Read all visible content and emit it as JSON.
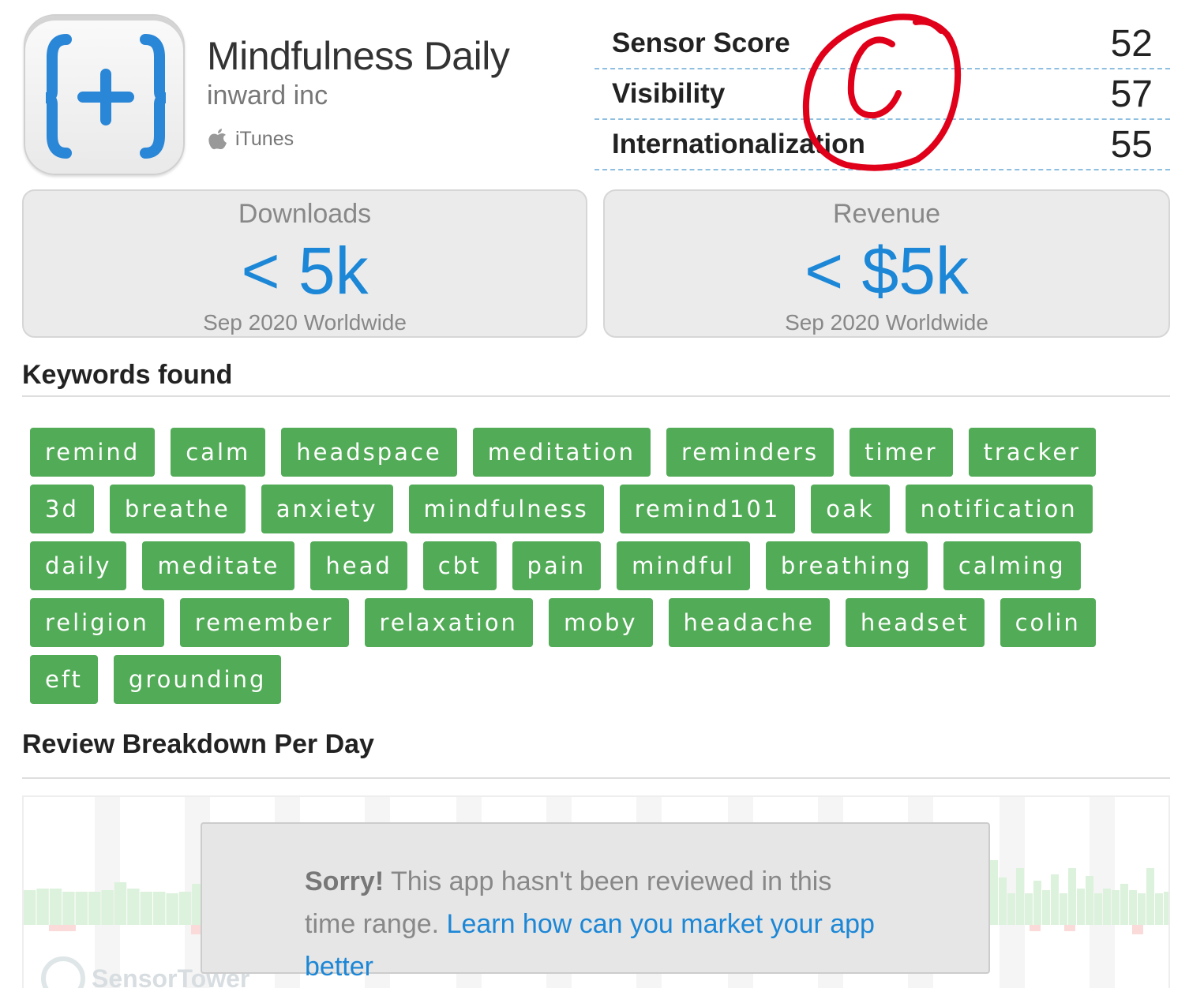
{
  "app": {
    "title": "Mindfulness Daily",
    "developer": "inward inc",
    "store": "iTunes",
    "icon": "bracket-plus-icon",
    "accent": "#1c87d6"
  },
  "scores": [
    {
      "name": "Sensor Score",
      "value": "52"
    },
    {
      "name": "Visibility",
      "value": "57"
    },
    {
      "name": "Internationalization",
      "value": "55"
    }
  ],
  "grade": {
    "letter": "C",
    "color": "#e0001a"
  },
  "downloads": {
    "heading": "Downloads",
    "value": "< 5k",
    "sub": "Sep 2020 Worldwide"
  },
  "revenue": {
    "heading": "Revenue",
    "value": "< $5k",
    "sub": "Sep 2020 Worldwide"
  },
  "keywords": {
    "title": "Keywords found",
    "color": "#52ab57",
    "items": [
      "remind",
      "calm",
      "headspace",
      "meditation",
      "reminders",
      "timer",
      "tracker",
      "3d",
      "breathe",
      "anxiety",
      "mindfulness",
      "remind101",
      "oak",
      "notification",
      "daily",
      "meditate",
      "head",
      "cbt",
      "pain",
      "mindful",
      "breathing",
      "calming",
      "religion",
      "remember",
      "relaxation",
      "moby",
      "headache",
      "headset",
      "colin",
      "eft",
      "grounding"
    ]
  },
  "reviews": {
    "title": "Review Breakdown Per Day",
    "sorry": "Sorry!",
    "message": " This app hasn't been reviewed in this time range. ",
    "link": "Learn how can you market your app better",
    "watermark": "SensorTower"
  }
}
